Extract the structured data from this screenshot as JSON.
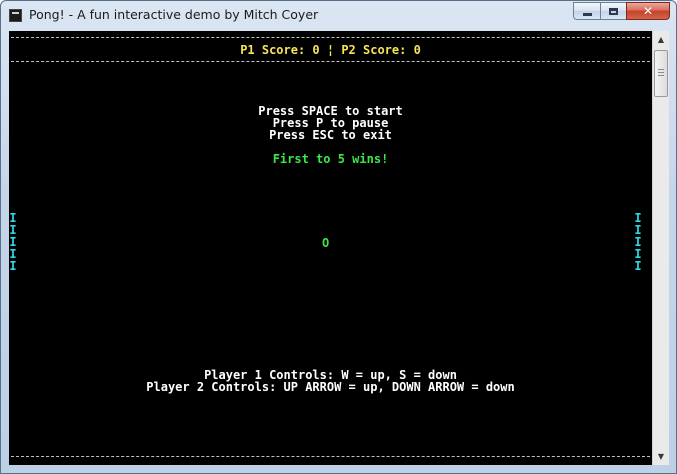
{
  "window": {
    "title": "Pong! - A fun interactive demo by Mitch Coyer",
    "close_glyph": "✕"
  },
  "game": {
    "scoreboard": "P1 Score: 0 ¦ P2 Score: 0",
    "instructions": [
      "Press SPACE to start",
      "Press P to pause",
      "Press ESC to exit"
    ],
    "win_message": "First to 5 wins!",
    "ball": "O",
    "paddle_glyph": "I",
    "controls": [
      "Player 1 Controls: W = up, S = down",
      "Player 2 Controls: UP ARROW = up, DOWN ARROW = down"
    ]
  },
  "scrollbar": {
    "up_glyph": "▲",
    "down_glyph": "▼"
  },
  "colors": {
    "background": "#000000",
    "score_text": "#f5e35a",
    "instruction_text": "#ffffff",
    "win_text": "#3ce64a",
    "paddle": "#2ed6e6",
    "ball": "#3ce64a"
  },
  "icons": {
    "app": "console-app-icon",
    "minimize": "minimize-icon",
    "maximize": "maximize-icon",
    "close": "close-icon"
  }
}
